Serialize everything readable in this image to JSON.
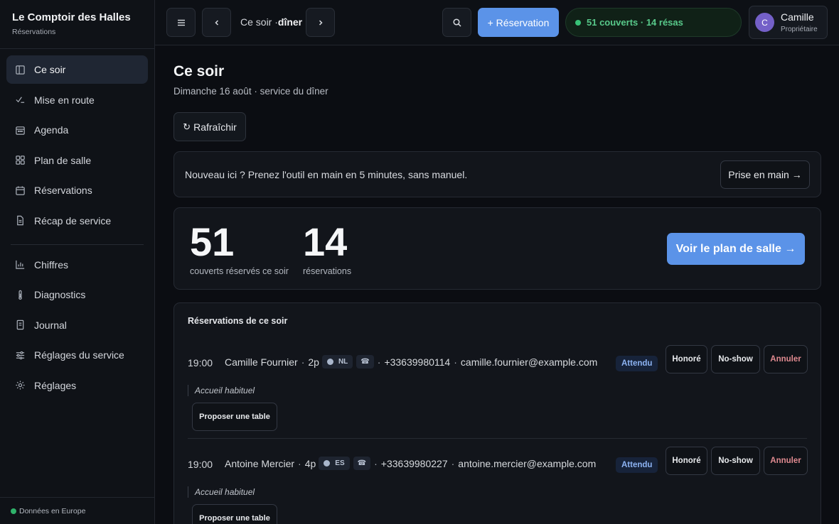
{
  "brand": {
    "name": "Le Comptoir des Halles",
    "subtitle": "Réservations"
  },
  "sidebar": {
    "items": [
      {
        "label": "Ce soir",
        "icon": "book-open-icon",
        "active": true
      },
      {
        "label": "Mise en route",
        "icon": "checklist-icon"
      },
      {
        "label": "Agenda",
        "icon": "calendar-icon"
      },
      {
        "label": "Plan de salle",
        "icon": "grid-icon"
      },
      {
        "label": "Réservations",
        "icon": "calendar-icon"
      },
      {
        "label": "Récap de service",
        "icon": "document-icon"
      },
      {
        "label": "Chiffres",
        "icon": "bar-chart-icon"
      },
      {
        "label": "Diagnostics",
        "icon": "thermometer-icon"
      },
      {
        "label": "Journal",
        "icon": "document-icon"
      },
      {
        "label": "Réglages du service",
        "icon": "sliders-icon"
      },
      {
        "label": "Réglages",
        "icon": "sun-gear-icon"
      }
    ],
    "footer": "Données en Europe"
  },
  "topbar": {
    "breadcrumb_prefix": "Ce soir ·",
    "breadcrumb_current": "dîner",
    "new_reservation": "+ Réservation",
    "status": "51 couverts · 14 résas",
    "user": {
      "initial": "C",
      "name": "Camille",
      "role": "Propriétaire"
    }
  },
  "page": {
    "title": "Ce soir",
    "subtitle": "Dimanche 16 août · service du dîner",
    "refresh": "Rafraîchir"
  },
  "onboarding": {
    "text": "Nouveau ici ? Prenez l'outil en main en 5 minutes, sans manuel.",
    "button": "Prise en main →"
  },
  "stats": {
    "covers": {
      "value": "51",
      "label": "couverts réservés ce soir"
    },
    "reservations": {
      "value": "14",
      "label": "réservations"
    },
    "plan_button": "Voir le plan de salle →"
  },
  "reservations": {
    "title": "Réservations de ce soir",
    "rows": [
      {
        "time": "19:00",
        "name": "Camille Fournier",
        "party": "2p",
        "lang": "NL",
        "phone": "+33639980114",
        "email": "camille.fournier@example.com",
        "status": "Attendu",
        "note": "Accueil habituel"
      },
      {
        "time": "19:00",
        "name": "Antoine Mercier",
        "party": "4p",
        "lang": "ES",
        "phone": "+33639980227",
        "email": "antoine.mercier@example.com",
        "status": "Attendu",
        "note": "Accueil habituel"
      }
    ],
    "actions": {
      "honore": "Honoré",
      "noshow": "No-show",
      "annuler": "Annuler",
      "propose": "Proposer une table"
    }
  },
  "colors": {
    "accent": "#5b93e8",
    "success": "#38c277",
    "danger": "#e08a90",
    "avatar": "#7460c8"
  }
}
